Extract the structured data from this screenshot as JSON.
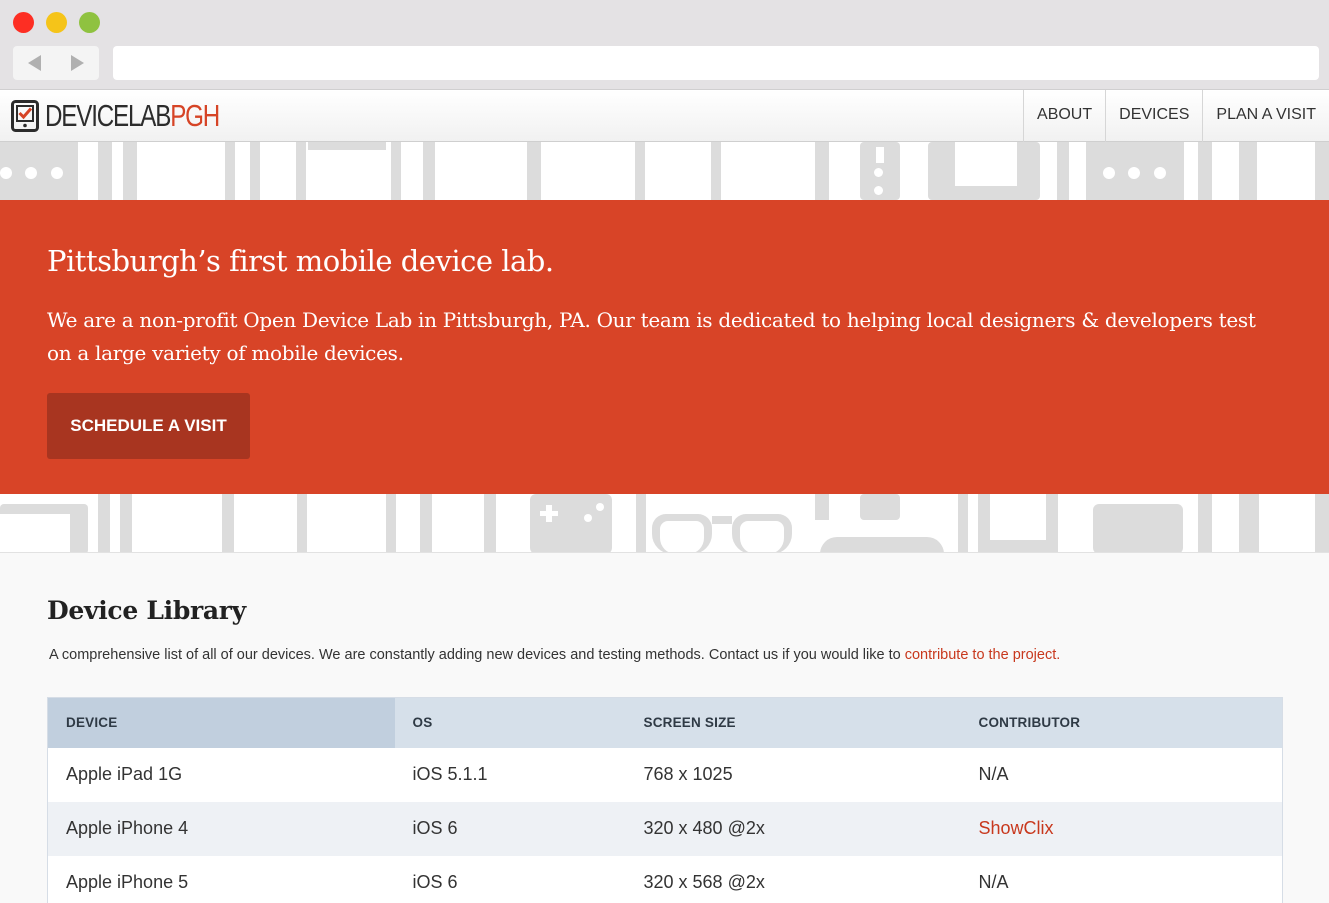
{
  "brand": {
    "logo_dark": "DEVICELAB",
    "logo_red": "PGH",
    "accent": "#d84427",
    "button_dark": "#a83520"
  },
  "nav": {
    "items": [
      "ABOUT",
      "DEVICES",
      "PLAN A VISIT"
    ]
  },
  "hero": {
    "title": "Pittsburgh’s first mobile device lab.",
    "body": "We are a non-profit Open Device Lab in Pittsburgh, PA. Our team is dedicated to helping local designers & developers test on a large variety of mobile devices.",
    "cta": "SCHEDULE A VISIT"
  },
  "library": {
    "title": "Device Library",
    "desc": "A comprehensive list of all of our devices. We are constantly adding new devices and testing methods. Contact us if you would like to ",
    "desc_link": "contribute to the project.",
    "columns": [
      "DEVICE",
      "OS",
      "SCREEN SIZE",
      "CONTRIBUTOR"
    ],
    "rows": [
      {
        "device": "Apple iPad 1G",
        "os": "iOS 5.1.1",
        "screen": "768 x 1025",
        "contributor": "N/A"
      },
      {
        "device": "Apple iPhone 4",
        "os": "iOS 6",
        "screen": "320 x 480 @2x",
        "contributor": "ShowClix"
      },
      {
        "device": "Apple iPhone 5",
        "os": "iOS 6",
        "screen": "320 x 568 @2x",
        "contributor": "N/A"
      }
    ]
  }
}
